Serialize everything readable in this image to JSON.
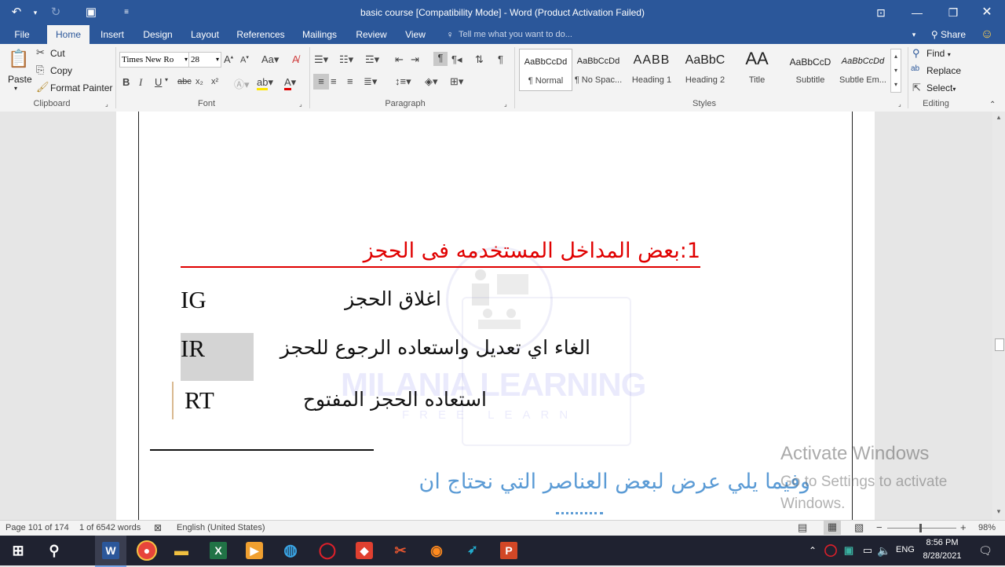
{
  "window": {
    "title": "basic course [Compatibility Mode] - Word (Product Activation Failed)"
  },
  "menu": {
    "tabs": [
      "File",
      "Home",
      "Insert",
      "Design",
      "Layout",
      "References",
      "Mailings",
      "Review",
      "View"
    ],
    "tell_me": "Tell me what you want to do...",
    "share": "Share"
  },
  "clipboard": {
    "paste": "Paste",
    "cut": "Cut",
    "copy": "Copy",
    "format_painter": "Format Painter",
    "label": "Clipboard"
  },
  "font": {
    "name": "Times New Ro",
    "size": "28",
    "label": "Font"
  },
  "paragraph": {
    "label": "Paragraph"
  },
  "styles": {
    "label": "Styles",
    "items": [
      {
        "preview": "AaBbCcDd",
        "name": "¶ Normal"
      },
      {
        "preview": "AaBbCcDd",
        "name": "¶ No Spac..."
      },
      {
        "preview": "AABB",
        "name": "Heading 1"
      },
      {
        "preview": "AaBbC",
        "name": "Heading 2"
      },
      {
        "preview": "AA",
        "name": "Title"
      },
      {
        "preview": "AaBbCcD",
        "name": "Subtitle"
      },
      {
        "preview": "AaBbCcDd",
        "name": "Subtle Em..."
      }
    ]
  },
  "editing": {
    "find": "Find",
    "replace": "Replace",
    "select": "Select",
    "label": "Editing"
  },
  "document": {
    "heading": "1:بعض المداخل المستخدمه فى الحجز",
    "rows": [
      {
        "code": "IG",
        "text": "اغلاق الحجز"
      },
      {
        "code": "IR",
        "text": "الغاء اي تعديل واستعاده الرجوع للحجز"
      },
      {
        "code": "RT",
        "text": "استعاده الحجز المفتوح"
      }
    ],
    "paragraph": "وفيما يلي عرض لبعض العناصر التي نحتاج ان",
    "watermark": {
      "main": "MILANIA LEARNING",
      "sub": "FREE LEARN"
    }
  },
  "activation": {
    "title": "Activate Windows",
    "subtitle": "Go to Settings to activate Windows."
  },
  "status": {
    "page": "Page 101 of 174",
    "words": "1 of 6542 words",
    "language": "English (United States)",
    "zoom": "98%"
  },
  "taskbar": {
    "time": "8:56 PM",
    "date": "8/28/2021",
    "lang": "ENG"
  },
  "colors": {
    "word_blue": "#2b579a",
    "heading_red": "#e00000",
    "paragraph_blue": "#5b9bd5"
  }
}
